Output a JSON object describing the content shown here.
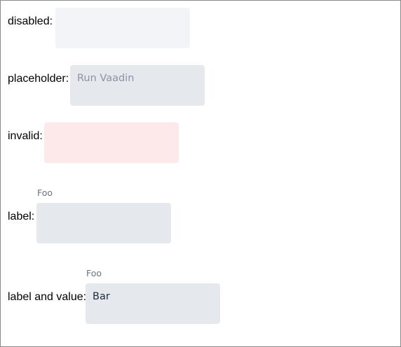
{
  "rows": {
    "disabled": {
      "label": "disabled:"
    },
    "placeholder": {
      "label": "placeholder:",
      "placeholder": "Run Vaadin"
    },
    "invalid": {
      "label": "invalid:"
    },
    "label": {
      "label": "label:",
      "field_label": "Foo"
    },
    "label_and_value": {
      "label": "label and value:",
      "field_label": "Foo",
      "value": "Bar"
    }
  },
  "colors": {
    "field_background": "#e5e8ed",
    "disabled_background": "#f3f4f7",
    "invalid_background": "#fde9e9",
    "placeholder_text": "#8c939f",
    "value_text": "#1f2a3c",
    "field_label_text": "#6b7280"
  }
}
